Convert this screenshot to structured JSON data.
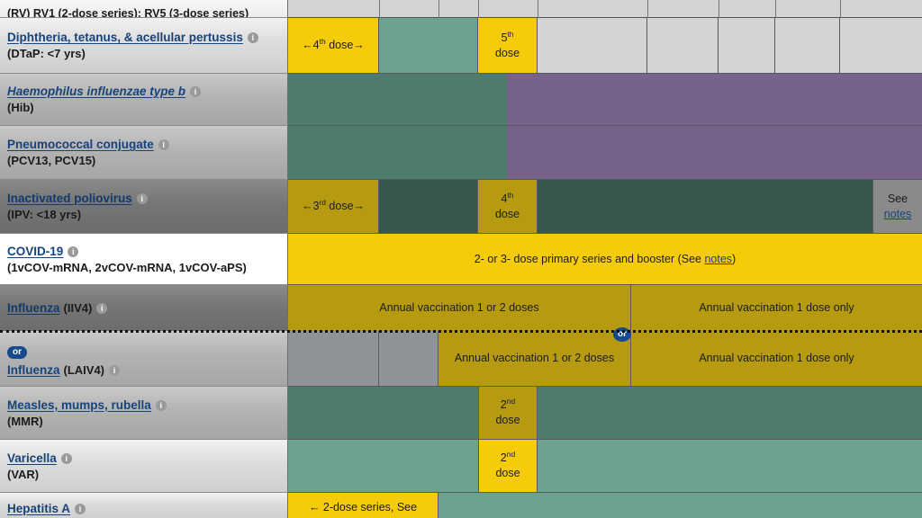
{
  "meta": {
    "top_partial_text": "(RV) RV1 (2-dose series); RV5 (3-dose series)"
  },
  "colors": {
    "yellow": "#f6cb0a",
    "yellow_dim": "#b69b10",
    "green": "#6ba38e",
    "green_dim": "#4e7c6b",
    "green_dimmer": "#39574c",
    "purple": "#9b7fae",
    "purple_dim": "#77628a",
    "grey": "#d4d4d4",
    "link_blue": "#17437c",
    "or_badge": "#174a8b"
  },
  "icons": {
    "info": "i",
    "or": "or"
  },
  "rows": [
    {
      "id": "dtap",
      "name": "Diphtheria, tetanus, & acellular pertussis",
      "name_style": "normal",
      "sub": "(DTaP: <7 yrs)",
      "has_info": true,
      "cells": [
        {
          "label": "←4th dose→",
          "sup": "th",
          "prefix": "←4",
          "suffix": " dose→",
          "fill": "yellow"
        },
        {
          "label": "",
          "fill": "green"
        },
        {
          "label": "5th dose",
          "prefix": "5",
          "sup": "th",
          "suffix": "dose",
          "fill": "yellow"
        },
        {
          "label": "",
          "fill": "grey"
        }
      ]
    },
    {
      "id": "hib",
      "name": "Haemophilus influenzae type b",
      "name_style": "italic",
      "sub": "(Hib)",
      "has_info": true,
      "cells": [
        {
          "label": "",
          "fill": "green_dim"
        },
        {
          "label": "",
          "fill": "purple_dim"
        }
      ]
    },
    {
      "id": "pcv",
      "name": "Pneumococcal conjugate",
      "name_style": "normal",
      "sub": "(PCV13, PCV15)",
      "has_info": true,
      "cells": [
        {
          "label": "",
          "fill": "green_dim"
        },
        {
          "label": "",
          "fill": "purple_dim"
        }
      ]
    },
    {
      "id": "ipv",
      "name": "Inactivated poliovirus",
      "name_style": "normal",
      "sub": "(IPV: <18 yrs)",
      "has_info": true,
      "cells": [
        {
          "label": "←3rd dose→",
          "prefix": "←3",
          "sup": "rd",
          "suffix": " dose→",
          "fill": "yellow_dim"
        },
        {
          "label": "",
          "fill": "green_dimmer"
        },
        {
          "label": "4th dose",
          "prefix": "4",
          "sup": "th",
          "suffix": "dose",
          "fill": "yellow_dim"
        },
        {
          "label": "",
          "fill": "green_dimmer"
        },
        {
          "label": "See notes",
          "fill": "grey_note",
          "link": "notes"
        }
      ]
    },
    {
      "id": "covid19",
      "name": "COVID-19",
      "name_style": "normal",
      "sub": "(1vCOV-mRNA, 2vCOV-mRNA, 1vCOV-aPS)",
      "has_info": true,
      "cells": [
        {
          "label": "2- or 3- dose primary series and booster (See notes)",
          "fill": "yellow",
          "link": "notes"
        }
      ]
    },
    {
      "id": "influenza-iiv4",
      "name": "Influenza",
      "name_style": "normal",
      "paren": "(IIV4)",
      "has_info": true,
      "cells": [
        {
          "label": "Annual vaccination 1 or 2 doses",
          "fill": "yellow_dim"
        },
        {
          "label": "Annual vaccination 1 dose only",
          "fill": "yellow_dim"
        }
      ]
    },
    {
      "id": "influenza-laiv4",
      "name": "Influenza",
      "name_style": "normal",
      "paren": "(LAIV4)",
      "has_info": true,
      "or_badge": "or",
      "cells": [
        {
          "label": "",
          "fill": "grey_dim"
        },
        {
          "label": "",
          "fill": "grey_dim"
        },
        {
          "label": "Annual vaccination 1 or 2 doses",
          "fill": "yellow_dim"
        },
        {
          "label": "Annual vaccination 1 dose only",
          "fill": "yellow_dim"
        }
      ]
    },
    {
      "id": "mmr",
      "name": "Measles, mumps, rubella",
      "name_style": "normal",
      "sub": "(MMR)",
      "has_info": true,
      "cells": [
        {
          "label": "",
          "fill": "green_dim"
        },
        {
          "label": "2nd dose",
          "prefix": "2",
          "sup": "nd",
          "suffix": "dose",
          "fill": "yellow_dim"
        },
        {
          "label": "",
          "fill": "green_dim"
        }
      ]
    },
    {
      "id": "var",
      "name": "Varicella",
      "name_style": "normal",
      "sub": "(VAR)",
      "has_info": true,
      "cells": [
        {
          "label": "",
          "fill": "green"
        },
        {
          "label": "2nd dose",
          "prefix": "2",
          "sup": "nd",
          "suffix": "dose",
          "fill": "yellow"
        },
        {
          "label": "",
          "fill": "green"
        }
      ]
    },
    {
      "id": "hepa",
      "name": "Hepatitis A",
      "name_style": "normal",
      "sub": "",
      "has_info": true,
      "cells": [
        {
          "label": "← 2-dose series, See",
          "fill": "yellow"
        },
        {
          "label": "",
          "fill": "green"
        }
      ]
    }
  ],
  "text": {
    "dtap_dose4": "←4",
    "dtap_dose4_sup": "th",
    "dtap_dose4_tail": " dose→",
    "dtap_dose5_num": "5",
    "dtap_dose5_sup": "th",
    "dtap_dose5_word": "dose",
    "ipv_dose3": "←3",
    "ipv_dose3_sup": "rd",
    "ipv_dose3_tail": " dose→",
    "ipv_dose4_num": "4",
    "ipv_dose4_sup": "th",
    "ipv_dose4_word": "dose",
    "see": "See",
    "notes": "notes",
    "covid_text_a": "2- or 3- dose primary series and booster (See ",
    "covid_notes": "notes",
    "covid_text_b": ")",
    "flu_1or2": "Annual vaccination 1 or 2 doses",
    "flu_1only": "Annual vaccination 1 dose only",
    "flu_laiv_1or2": "Annual vaccination 1 or 2 doses",
    "mmr_dose2_num": "2",
    "mmr_dose2_sup": "nd",
    "mmr_dose2_word": "dose",
    "var_dose2_num": "2",
    "var_dose2_sup": "nd",
    "var_dose2_word": "dose",
    "hepa_series": "← 2-dose series, See"
  },
  "labels": {
    "dtap_name": "Diphtheria, tetanus, & acellular pertussis",
    "dtap_sub": "(DTaP: <7 yrs)",
    "hib_name": "Haemophilus influenzae type b",
    "hib_sub": "(Hib)",
    "pcv_name": "Pneumococcal conjugate",
    "pcv_sub": "(PCV13, PCV15)",
    "ipv_name": "Inactivated poliovirus",
    "ipv_sub": "(IPV: <18 yrs)",
    "covid_name": "COVID-19",
    "covid_sub": "(1vCOV-mRNA, 2vCOV-mRNA, 1vCOV-aPS)",
    "flu_name": "Influenza",
    "flu_iiv4": "(IIV4)",
    "flu_laiv4": "(LAIV4)",
    "or": "or",
    "mmr_name": "Measles, mumps, rubella",
    "mmr_sub": "(MMR)",
    "var_name": "Varicella",
    "var_sub": "(VAR)",
    "hepa_name": "Hepatitis A",
    "top_partial": "(RV) RV1 (2-dose series); RV5 (3-dose series)"
  }
}
